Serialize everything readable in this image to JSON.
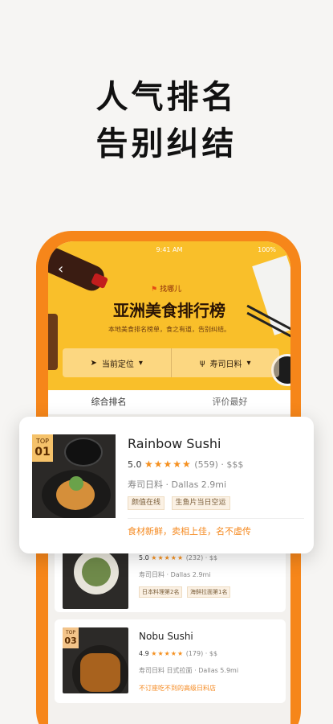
{
  "headline": {
    "line1": "人气排名",
    "line2": "告别纠结"
  },
  "status_bar": {
    "time": "9:41 AM",
    "battery": "100%"
  },
  "banner": {
    "brand": "找哪儿",
    "title": "亚洲美食排行榜",
    "subtitle": "本地美食排名榜单，食之有道，告别纠结。",
    "accent_color": "#f9bf2a"
  },
  "filters": [
    {
      "icon": "location-arrow-icon",
      "label": "当前定位"
    },
    {
      "icon": "fork-knife-icon",
      "label": "寿司日料"
    }
  ],
  "tabs": [
    {
      "label": "综合排名",
      "active": true
    },
    {
      "label": "评价最好",
      "active": false
    }
  ],
  "featured": {
    "rank_top": "TOP",
    "rank_num": "01",
    "name": "Rainbow Sushi",
    "score": "5.0",
    "stars": "★★★★★",
    "reviews": "(559)",
    "price": "$$$",
    "cuisine": "寿司日料",
    "location": "Dallas 2.9mi",
    "tags": [
      "颜值在线",
      "生鱼片当日空运"
    ],
    "note": "食材新鲜，卖相上佳，名不虚传"
  },
  "list": [
    {
      "rank_top": "",
      "rank_num": "",
      "name": "",
      "score": "5.0",
      "stars": "★★★★★",
      "reviews": "(232)",
      "price": "$$",
      "cuisine": "寿司日料",
      "location": "Dallas 2.9mi",
      "tags": [
        "日本料理第2名",
        "海鲜拉面第1名"
      ],
      "note": ""
    },
    {
      "rank_top": "TOP",
      "rank_num": "03",
      "name": "Nobu Sushi",
      "score": "4.9",
      "stars": "★★★★★",
      "reviews": "(179)",
      "price": "$$",
      "cuisine": "寿司日料 日式拉面",
      "location": "Dallas 5.9mi",
      "tags": [],
      "note": "不订座吃不到的高级日料店"
    }
  ],
  "colors": {
    "brand_orange": "#f6861a",
    "star": "#f5901f",
    "note": "#f58a21"
  }
}
